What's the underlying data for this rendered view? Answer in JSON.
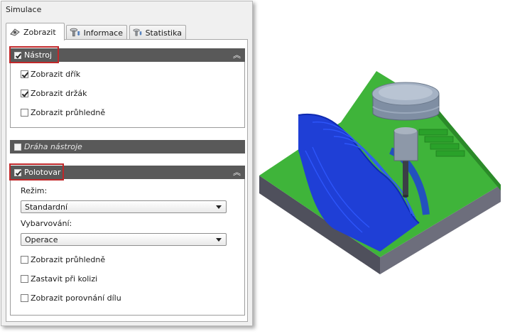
{
  "panel": {
    "title": "Simulace",
    "tabs": [
      {
        "label": "Zobrazit",
        "icon": "display-eye-icon"
      },
      {
        "label": "Informace",
        "icon": "tool-info-icon"
      },
      {
        "label": "Statistika",
        "icon": "tool-stats-icon"
      }
    ],
    "sections": {
      "tool": {
        "label": "Nástroj",
        "checked": true,
        "items": [
          {
            "label": "Zobrazit dřík",
            "checked": true
          },
          {
            "label": "Zobrazit držák",
            "checked": true
          },
          {
            "label": "Zobrazit průhledně",
            "checked": false
          }
        ]
      },
      "toolpath": {
        "label": "Dráha nástroje",
        "checked": false
      },
      "stock": {
        "label": "Polotovar",
        "checked": true,
        "mode_label": "Režim:",
        "mode_value": "Standardní",
        "color_label": "Vybarvování:",
        "color_value": "Operace",
        "items": [
          {
            "label": "Zobrazit průhledně",
            "checked": false
          },
          {
            "label": "Zastavit při kolizi",
            "checked": false
          },
          {
            "label": "Zobrazit porovnání dílu",
            "checked": false
          }
        ]
      }
    }
  },
  "colors": {
    "header_bar": "#595959",
    "highlight": "#c0282a",
    "stock_green": "#3fb43a",
    "machined_blue": "#1f3fd6",
    "base_gray": "#5b5c6a"
  }
}
